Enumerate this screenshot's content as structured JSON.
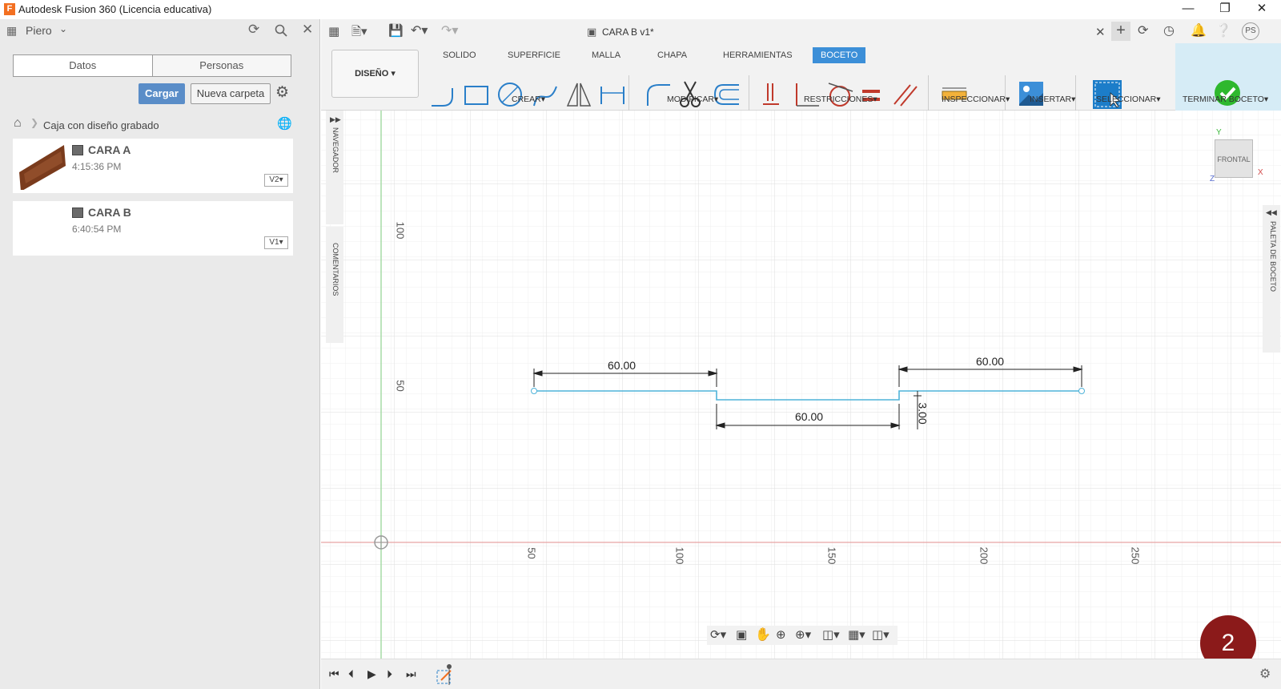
{
  "window": {
    "title": "Autodesk Fusion 360 (Licencia educativa)",
    "icon": "F"
  },
  "left_panel": {
    "user": "Piero",
    "tabs": [
      "Datos",
      "Personas"
    ],
    "upload_label": "Cargar",
    "new_folder_label": "Nueva carpeta",
    "breadcrumb": "Caja con diseño grabado",
    "items": [
      {
        "name": "CARA A",
        "time": "4:15:36 PM",
        "version": "V2"
      },
      {
        "name": "CARA B",
        "time": "6:40:54 PM",
        "version": "V1"
      }
    ]
  },
  "document": {
    "tab_title": "CARA B v1*"
  },
  "user_initials": "PS",
  "ribbon": {
    "workspace": "DISEÑO",
    "tabs": [
      "SOLIDO",
      "SUPERFICIE",
      "MALLA",
      "CHAPA",
      "HERRAMIENTAS",
      "BOCETO"
    ],
    "active_tab": "BOCETO",
    "groups": [
      "CREAR",
      "MODIFICAR",
      "RESTRICCIONES",
      "INSPECCIONAR",
      "INSERTAR",
      "SELECCIONAR",
      "TERMINAR BOCETO"
    ]
  },
  "side_panels": {
    "navigator": "NAVEGADOR",
    "comments": "COMENTARIOS",
    "palette": "PALETA DE BOCETO"
  },
  "view_cube": {
    "face": "FRONTAL",
    "axes": [
      "Y",
      "X",
      "Z"
    ]
  },
  "sketch": {
    "axis_labels_x": [
      "50",
      "100",
      "150",
      "200",
      "250"
    ],
    "axis_labels_y": [
      "100",
      "50"
    ],
    "dimensions": [
      "60.00",
      "60.00",
      "60.00",
      "3.00"
    ]
  },
  "step_badge": "2",
  "colors": {
    "accent": "#3c8fd8",
    "sketch_line": "#4fb3d9",
    "finish": "#2eb82e",
    "badge": "#8b1a1a"
  }
}
